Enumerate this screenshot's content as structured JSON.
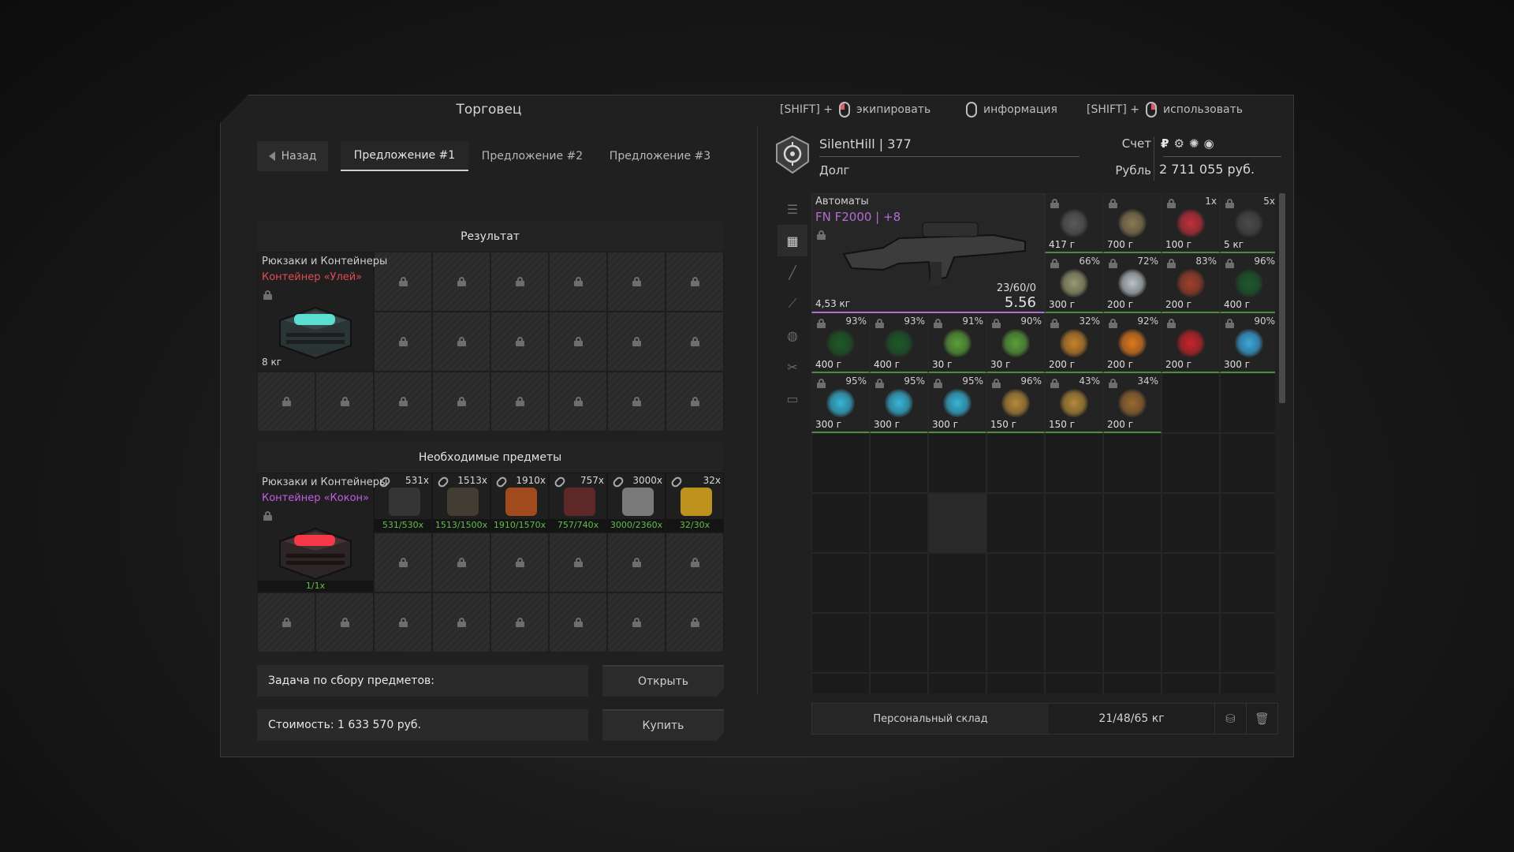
{
  "trader": {
    "title": "Торговец",
    "back_label": "Назад",
    "tabs": [
      {
        "label": "Предложение #1",
        "active": true
      },
      {
        "label": "Предложение #2",
        "active": false
      },
      {
        "label": "Предложение #3",
        "active": false
      }
    ],
    "result": {
      "title": "Результат",
      "category": "Рюкзаки и Контейнеры",
      "item_name": "Контейнер «Улей»",
      "item_color": "#e04b55",
      "weight": "8 кг"
    },
    "required": {
      "title": "Необходимые предметы",
      "category": "Рюкзаки и Контейнеры",
      "item_name": "Контейнер «Кокон»",
      "item_color": "#c05fe0",
      "item_progress": "1/1x",
      "items": [
        {
          "count": "531x",
          "progress": "531/530x"
        },
        {
          "count": "1513x",
          "progress": "1513/1500x"
        },
        {
          "count": "1910x",
          "progress": "1910/1570x"
        },
        {
          "count": "757x",
          "progress": "757/740x"
        },
        {
          "count": "3000x",
          "progress": "3000/2360x"
        },
        {
          "count": "32x",
          "progress": "32/30x"
        }
      ]
    },
    "task_label": "Задача по сбору предметов:",
    "open_button": "Открыть",
    "cost_label": "Стоимость: 1 633 570 руб.",
    "buy_button": "Купить"
  },
  "hints": {
    "shift1": "[SHIFT] +",
    "equip": "экипировать",
    "info": "информация",
    "shift2": "[SHIFT] +",
    "use": "использовать"
  },
  "profile": {
    "player": "SilentHill | 377",
    "debt_label": "Долг",
    "account_label": "Счет",
    "currency_label": "Рубль",
    "balance": "2 711 055 руб.",
    "currency_symbol": "₽"
  },
  "inventory": {
    "weapon": {
      "category": "Автоматы",
      "name": "FN F2000 | +8",
      "weight": "4,53 кг",
      "ammo": "23/60/0",
      "caliber": "5.56"
    },
    "items": [
      {
        "pct": "",
        "weight": "417 г",
        "color": "#5a5a5a",
        "icon": "gear-icon"
      },
      {
        "pct": "",
        "weight": "700 г",
        "color": "#8a7a55",
        "icon": "bag-icon"
      },
      {
        "pct": "1x",
        "weight": "100 г",
        "color": "#c2303a",
        "icon": "tool-icon"
      },
      {
        "pct": "5x",
        "weight": "5 кг",
        "color": "#4a4a4a",
        "icon": "box-icon"
      },
      {
        "pct": "66%",
        "weight": "300 г",
        "color": "#9a9a72",
        "icon": "map-icon"
      },
      {
        "pct": "72%",
        "weight": "200 г",
        "color": "#b8c2c8",
        "icon": "crystal-icon"
      },
      {
        "pct": "83%",
        "weight": "200 г",
        "color": "#a0402c",
        "icon": "artifact-icon"
      },
      {
        "pct": "96%",
        "weight": "400 г",
        "color": "#1c5a2c",
        "icon": "artifact-icon"
      },
      {
        "pct": "93%",
        "weight": "400 г",
        "color": "#1d5a28",
        "icon": "artifact-icon"
      },
      {
        "pct": "93%",
        "weight": "400 г",
        "color": "#1d5a28",
        "icon": "artifact-icon"
      },
      {
        "pct": "91%",
        "weight": "30 г",
        "color": "#5aa03a",
        "icon": "leaf-icon"
      },
      {
        "pct": "90%",
        "weight": "30 г",
        "color": "#5aa03a",
        "icon": "leaf-icon"
      },
      {
        "pct": "32%",
        "weight": "200 г",
        "color": "#c6832c",
        "icon": "artifact-icon"
      },
      {
        "pct": "92%",
        "weight": "200 г",
        "color": "#e07a1e",
        "icon": "artifact-icon"
      },
      {
        "pct": "",
        "weight": "200 г",
        "color": "#c8252a",
        "icon": "artifact-icon"
      },
      {
        "pct": "90%",
        "weight": "300 г",
        "color": "#3aa8e0",
        "icon": "artifact-icon"
      },
      {
        "pct": "95%",
        "weight": "300 г",
        "color": "#37b6d8",
        "icon": "artifact-icon"
      },
      {
        "pct": "95%",
        "weight": "300 г",
        "color": "#37b6d8",
        "icon": "artifact-icon"
      },
      {
        "pct": "95%",
        "weight": "300 г",
        "color": "#37b6d8",
        "icon": "artifact-icon"
      },
      {
        "pct": "96%",
        "weight": "150 г",
        "color": "#b58a3a",
        "icon": "artifact-icon"
      },
      {
        "pct": "43%",
        "weight": "150 г",
        "color": "#b58a3a",
        "icon": "artifact-icon"
      },
      {
        "pct": "34%",
        "weight": "200 г",
        "color": "#9a6a32",
        "icon": "artifact-icon"
      }
    ],
    "stash_label": "Персональный склад",
    "stash_weight": "21/48/65 кг"
  }
}
